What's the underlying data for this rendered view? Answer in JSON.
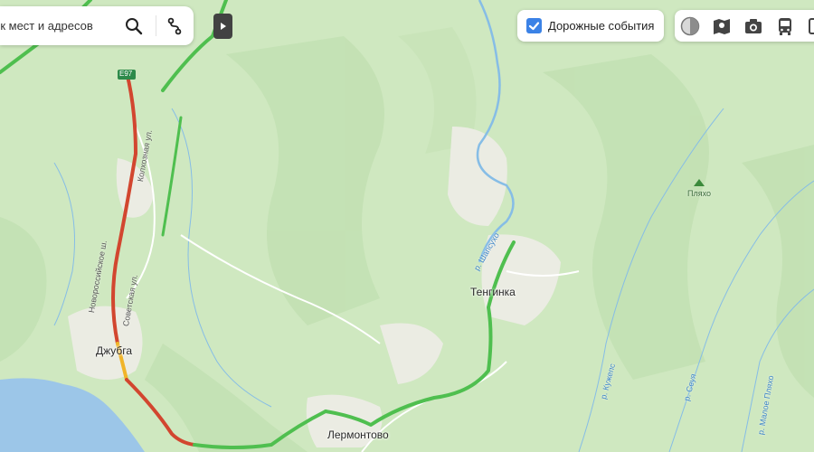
{
  "search": {
    "placeholder": "Поиск мест и адресов"
  },
  "events_toggle": {
    "label": "Дорожные события",
    "checked": true
  },
  "layers": [
    {
      "name": "map-mode-icon"
    },
    {
      "name": "panorama-map-icon"
    },
    {
      "name": "camera-icon"
    },
    {
      "name": "transport-icon"
    }
  ],
  "map_labels": {
    "road_shield": "E97",
    "street_kolkhoznaya": "Колхозная ул.",
    "street_novorossiyskoe": "Новороссийское ш.",
    "street_sovetskaya": "Советская ул.",
    "town_dzhubga": "Джубга",
    "town_tenginka": "Тенгинка",
    "town_lermontovo": "Лермонтово",
    "river_shapsuho": "р. Шапсухо",
    "river_kuzhepс": "р. Кужепс",
    "river_seuya": "р. Сеуя",
    "river_maloe_plyaho": "р. Малое Пляхо",
    "peak_plyaho": "Пляхо"
  },
  "colors": {
    "land": "#cfe8c0",
    "sea": "#9cc6e8",
    "road_congested": "#d2462f",
    "road_slow": "#f0b429",
    "road_free": "#4fbf4f",
    "accent": "#3b82e6"
  }
}
